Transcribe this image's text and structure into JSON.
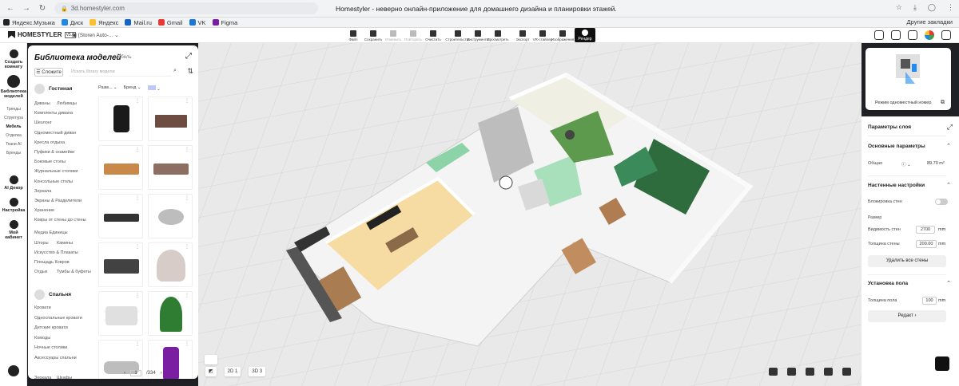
{
  "browser": {
    "url": "3d.homestyler.com",
    "title": "Homestyler - неверно онлайн-приложение для домашнего дизайна и планировки этажей.",
    "bookmarks": [
      {
        "label": "Яндекс.Музыка",
        "color": "#222222",
        "icon": "music-icon"
      },
      {
        "label": "Диск",
        "color": "#1e88e5",
        "icon": "disk-icon"
      },
      {
        "label": "Яндекс",
        "color": "#fbc02d",
        "icon": "yandex-icon"
      },
      {
        "label": "Mail.ru",
        "color": "#1565c0",
        "icon": "mail-icon"
      },
      {
        "label": "Gmail",
        "color": "#e53935",
        "icon": "gmail-icon"
      },
      {
        "label": "VK",
        "color": "#1976d2",
        "icon": "vk-icon"
      },
      {
        "label": "Figma",
        "color": "#7b1fa2",
        "icon": "figma-icon"
      }
    ],
    "other_bookmarks": "Другие закладки"
  },
  "app": {
    "logo": "HOMESTYLER",
    "version": "V5.6",
    "project": "[Storen Auto-...",
    "tools": [
      {
        "label": "Файл",
        "icon": "file-icon",
        "dim": false
      },
      {
        "label": "Сохранить",
        "icon": "save-icon",
        "dim": false
      },
      {
        "label": "Отменить",
        "icon": "undo-icon",
        "dim": true
      },
      {
        "label": "Повторить",
        "icon": "redo-icon",
        "dim": true
      },
      {
        "label": "Очистить",
        "icon": "clear-icon",
        "dim": false
      },
      {
        "label": "Строительство",
        "icon": "build-icon",
        "dim": false,
        "sep": true
      },
      {
        "label": "Инструменты",
        "icon": "tools-icon",
        "dim": false
      },
      {
        "label": "Просмотреть",
        "icon": "eye-icon",
        "dim": false
      },
      {
        "label": "Экспорт",
        "icon": "export-icon",
        "dim": false,
        "sep": true
      },
      {
        "label": "VR-стайлер",
        "icon": "vr-icon",
        "dim": false
      },
      {
        "label": "Изображения",
        "icon": "images-icon",
        "dim": false
      }
    ],
    "render": "Рендер"
  },
  "rail": {
    "items": [
      {
        "label": "Создать комнату",
        "icon": "create-room-icon"
      },
      {
        "label": "Библиотека моделей",
        "icon": "library-icon",
        "active": true
      },
      {
        "label": "AI Декор",
        "icon": "ai-decor-icon"
      },
      {
        "label": "Настройка",
        "icon": "settings-icon"
      },
      {
        "label": "Мой кабинет",
        "icon": "cabinet-icon"
      }
    ],
    "subs": [
      "Тренды",
      "Структура",
      "Мебель",
      "Отделка",
      "Ткани AI",
      "Бренды"
    ]
  },
  "library": {
    "title": "Библиотека моделей",
    "subtitle": "Мебель",
    "filter": "Сложите",
    "search_placeholder": "Искать library модели",
    "sort_size": "Разм...",
    "sort_brand": "Бренд",
    "group1": "Гостиная",
    "cats1": [
      "Диваны",
      "Любимцы",
      "Комплекты дивана",
      "Шезлонг",
      "Одноместный диван",
      "Кресла отдыха",
      "Пуфики & скамейки",
      "Боковые столы",
      "Журнальные столики",
      "Консольные столы",
      "Зеркала",
      "Экраны & Разделители",
      "Хранение",
      "Ковры от стены до стены",
      "Медиа Единицы",
      "Шторы",
      "Камины",
      "Искусство & Плакаты",
      "Площадь Ковров",
      "Отдых",
      "Тумбы & буфеты"
    ],
    "group2": "Спальня",
    "cats2": [
      "Кровати",
      "Односпальные кровати",
      "Детские кровати",
      "Комоды",
      "Ночные столики",
      "Аксессуары спальни",
      "Зеркала",
      "Шкафы",
      "Шторы"
    ],
    "tiles": [
      {
        "name": "boots-thumb",
        "color": "#1a1a1a"
      },
      {
        "name": "console-table-thumb",
        "color": "#6d4c41"
      },
      {
        "name": "wood-board-thumb",
        "color": "#c8894a"
      },
      {
        "name": "planter-thumb",
        "color": "#8d6e63"
      },
      {
        "name": "tv-stand-thumb",
        "color": "#333333"
      },
      {
        "name": "robot-vacuum-thumb",
        "color": "#bdbdbd"
      },
      {
        "name": "bed-thumb",
        "color": "#424242"
      },
      {
        "name": "round-table-thumb",
        "color": "#d7ccc8"
      },
      {
        "name": "dining-set-thumb",
        "color": "#e0e0e0"
      },
      {
        "name": "christmas-tree-thumb",
        "color": "#2e7d32"
      },
      {
        "name": "chaise-thumb",
        "color": "#bdbdbd"
      },
      {
        "name": "purple-chair-thumb",
        "color": "#7b1fa2"
      }
    ],
    "page": "1",
    "pages": "/334"
  },
  "minimap": {
    "label": "Режим одноместный номер"
  },
  "props": {
    "title": "Параметры слоя",
    "section1": "Основные параметры",
    "area_label": "Общая",
    "area_value": "89.70 m²",
    "section2": "Настенные настройки",
    "lock_label": "Блокировка стен",
    "size_label": "Размер",
    "wall_height_label": "Видимость стен",
    "wall_height": "2700",
    "wall_height_unit": "mm",
    "wall_thick_label": "Толщина стены",
    "wall_thick": "200.00",
    "wall_thick_unit": "mm",
    "delete_walls": "Удалить все стены",
    "section3": "Установка пола",
    "floor_thick_label": "Толщина пола",
    "floor_thick": "100",
    "floor_thick_unit": "mm",
    "edit_btn": "Редакт"
  },
  "bottom": {
    "floor_a": "2D 1",
    "floor_b": "3D 3"
  },
  "colors": {
    "accent": "#1d8cf8",
    "grid_bg": "#e6e6e6",
    "green_wall": "#8cd4a8",
    "dark_green": "#2e6b3d",
    "yellow_floor": "#f6dca3"
  }
}
